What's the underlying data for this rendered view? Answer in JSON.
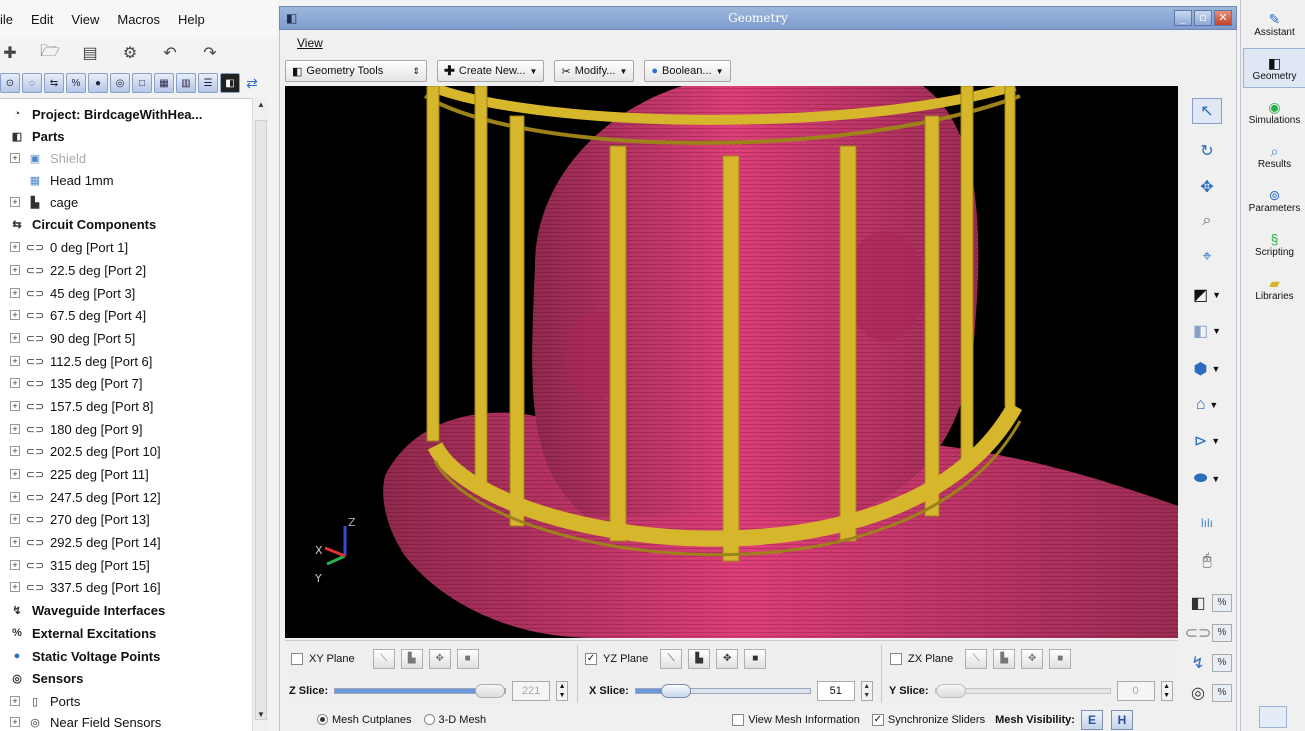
{
  "menu": {
    "items": [
      "ile",
      "Edit",
      "View",
      "Macros",
      "Help"
    ]
  },
  "quick_icons": [
    "plus-icon",
    "folder-open-icon",
    "save-icon",
    "wrench-icon",
    "undo-icon",
    "redo-icon"
  ],
  "tree": {
    "project": "Project: BirdcageWithHea...",
    "parts_label": "Parts",
    "parts": [
      "Shield",
      "Head 1mm",
      "cage"
    ],
    "circuit_label": "Circuit Components",
    "ports": [
      "0 deg [Port 1]",
      "22.5 deg [Port 2]",
      "45 deg [Port 3]",
      "67.5 deg [Port 4]",
      "90 deg [Port 5]",
      "112.5 deg [Port 6]",
      "135 deg [Port 7]",
      "157.5 deg [Port 8]",
      "180 deg [Port 9]",
      "202.5 deg [Port 10]",
      "225 deg [Port 11]",
      "247.5 deg [Port 12]",
      "270 deg [Port 13]",
      "292.5 deg [Port 14]",
      "315 deg [Port 15]",
      "337.5 deg [Port 16]"
    ],
    "waveguide": "Waveguide Interfaces",
    "external": "External Excitations",
    "static_voltage": "Static Voltage Points",
    "sensors": "Sensors",
    "sensor_ports": "Ports",
    "near_field": "Near Field Sensors"
  },
  "geometry_window": {
    "title": "Geometry",
    "menu_view": "View",
    "tools_label": "Geometry Tools",
    "create_label": "Create New...",
    "modify_label": "Modify...",
    "boolean_label": "Boolean..."
  },
  "axes": {
    "z": "Z",
    "x": "X",
    "y": "Y"
  },
  "planes": {
    "xy_label": "XY Plane",
    "yz_label": "YZ Plane",
    "zx_label": "ZX Plane",
    "xy_checked": false,
    "yz_checked": true,
    "zx_checked": false
  },
  "slices": {
    "z_label": "Z Slice:",
    "z_value": "221",
    "z_fraction": 1.0,
    "x_label": "X Slice:",
    "x_value": "51",
    "x_fraction": 0.23,
    "y_label": "Y Slice:",
    "y_value": "0",
    "y_fraction": 0.0
  },
  "bottom": {
    "mesh_cutplanes": "Mesh Cutplanes",
    "mesh_3d": "3-D Mesh",
    "view_mesh_info": "View Mesh Information",
    "sync_sliders": "Synchronize Sliders",
    "mesh_visibility": "Mesh Visibility:",
    "e_label": "E",
    "h_label": "H"
  },
  "pct_label": "%",
  "right_panel": {
    "items": [
      "Assistant",
      "Geometry",
      "Simulations",
      "Results",
      "Parameters",
      "Scripting",
      "Libraries"
    ]
  },
  "colors": {
    "head": "#e0407a",
    "cage": "#d6b62a",
    "viewport_bg": "#000000",
    "title_bar": "#8aa6d3"
  }
}
